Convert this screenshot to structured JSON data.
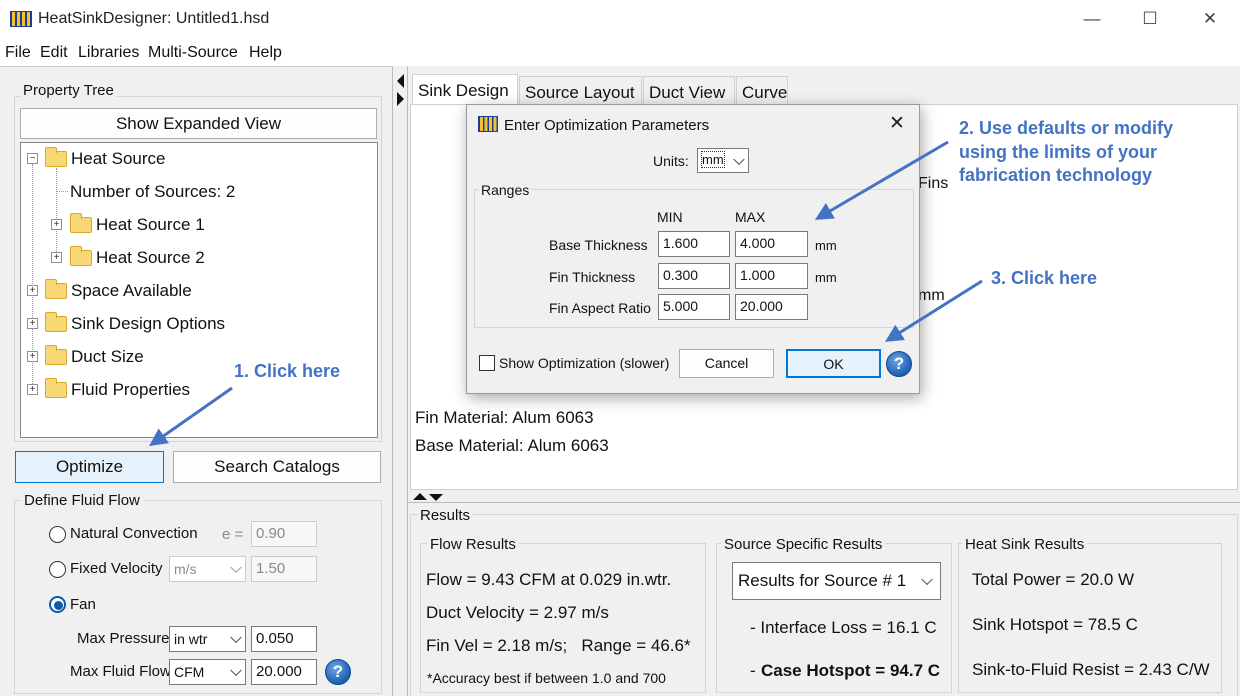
{
  "window": {
    "title": "HeatSinkDesigner: Untitled1.hsd",
    "minimize": "—",
    "maximize": "☐",
    "close": "✕"
  },
  "menu": [
    "File",
    "Edit",
    "Libraries",
    "Multi-Source",
    "Help"
  ],
  "left": {
    "tree_group_label": "Property Tree",
    "expand_button": "Show Expanded View",
    "tree": {
      "heat_source": "Heat Source",
      "num_sources": "Number of Sources: 2",
      "heat_source_1": "Heat Source 1",
      "heat_source_2": "Heat Source 2",
      "space_available": "Space Available",
      "sink_design_options": "Sink Design Options",
      "duct_size": "Duct Size",
      "fluid_properties": "Fluid Properties"
    },
    "optimize_button": "Optimize",
    "search_button": "Search Catalogs",
    "flow_group_label": "Define Fluid Flow",
    "natural_convection": "Natural Convection",
    "emissivity_label": "e =",
    "emissivity_value": "0.90",
    "fixed_velocity": "Fixed Velocity",
    "velocity_unit": "m/s",
    "velocity_value": "1.50",
    "fan": "Fan",
    "max_pressure_label": "Max Pressure",
    "pressure_unit": "in wtr",
    "pressure_value": "0.050",
    "max_flow_label": "Max Fluid Flow",
    "flow_unit": "CFM",
    "flow_value": "20.000",
    "selected_flow": "Fan"
  },
  "tabs": [
    "Sink Design",
    "Source Layout",
    "Duct View",
    "Curve"
  ],
  "canvas": {
    "fins_fragment": "Fins",
    "mm_fragment": "mm",
    "fin_material": "Fin Material: Alum 6063",
    "base_material": "Base Material: Alum 6063"
  },
  "dialog": {
    "title": "Enter Optimization Parameters",
    "units_label": "Units:",
    "units_value": "mm",
    "ranges_label": "Ranges",
    "min_header": "MIN",
    "max_header": "MAX",
    "rows": [
      {
        "label": "Base Thickness",
        "min": "1.600",
        "max": "4.000",
        "unit": "mm"
      },
      {
        "label": "Fin Thickness",
        "min": "0.300",
        "max": "1.000",
        "unit": "mm"
      },
      {
        "label": "Fin Aspect Ratio",
        "min": "5.000",
        "max": "20.000",
        "unit": ""
      }
    ],
    "show_optimization": "Show Optimization (slower)",
    "cancel": "Cancel",
    "ok": "OK",
    "help": "?"
  },
  "results": {
    "label": "Results",
    "flow_results": {
      "label": "Flow Results",
      "flow": "Flow = 9.43 CFM at 0.029 in.wtr.",
      "duct_velocity": "Duct Velocity = 2.97 m/s",
      "fin_vel": "Fin Vel = 2.18 m/s;   Range = 46.6*",
      "accuracy_note": "*Accuracy best if between 1.0 and 700"
    },
    "source_results": {
      "label": "Source Specific Results",
      "selector": "Results for Source # 1",
      "interface_loss": "- Interface Loss = 16.1 C",
      "case_hotspot_prefix": "- ",
      "case_hotspot": "Case Hotspot = 94.7 C"
    },
    "sink_results": {
      "label": "Heat Sink Results",
      "total_power": "Total Power = 20.0 W",
      "sink_hotspot": "Sink Hotspot = 78.5 C",
      "sink_to_fluid": "Sink-to-Fluid Resist = 2.43 C/W"
    }
  },
  "annotations": {
    "step1": "1. Click here",
    "step2_line1": "2. Use defaults or modify",
    "step2_line2": "using the limits of your",
    "step2_line3": "fabrication technology",
    "step3": "3. Click here",
    "color": "#4472c4"
  },
  "colors": {
    "accent": "#0b5cad",
    "annotation": "#4472c4",
    "help_icon": "#1d5fb3"
  }
}
